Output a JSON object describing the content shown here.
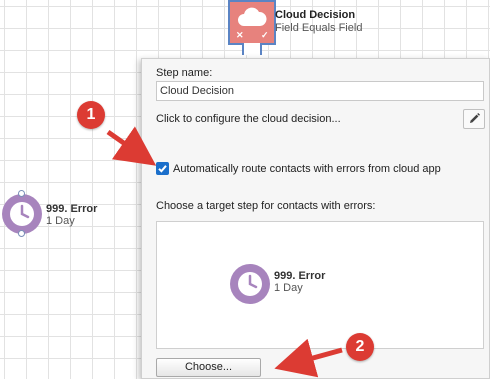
{
  "canvas": {
    "top_node": {
      "title": "Cloud Decision",
      "subtitle": "Field Equals Field",
      "icon": "cloud-icon",
      "status_marks": [
        "✕",
        "✓"
      ]
    },
    "left_node": {
      "title": "999. Error",
      "subtitle": "1 Day",
      "icon": "clock-icon"
    }
  },
  "panel": {
    "step_name_label": "Step name:",
    "step_name_value": "Cloud Decision",
    "configure_text": "Click to configure the cloud decision...",
    "edit_icon": "pencil-icon",
    "auto_route": {
      "label": "Automatically route contacts with errors from cloud app",
      "checked": true
    },
    "target_label": "Choose a target step for contacts with errors:",
    "target_node": {
      "title": "999. Error",
      "subtitle": "1 Day",
      "icon": "clock-icon"
    },
    "choose_button": "Choose..."
  },
  "annotations": [
    {
      "number": "1",
      "color": "#dc3b33"
    },
    {
      "number": "2",
      "color": "#dc3b33"
    }
  ],
  "colors": {
    "node_purple": "#a784bd",
    "decision_red": "#e7827d",
    "selection_blue": "#5b84c4",
    "annotation_red": "#dc3b33"
  }
}
